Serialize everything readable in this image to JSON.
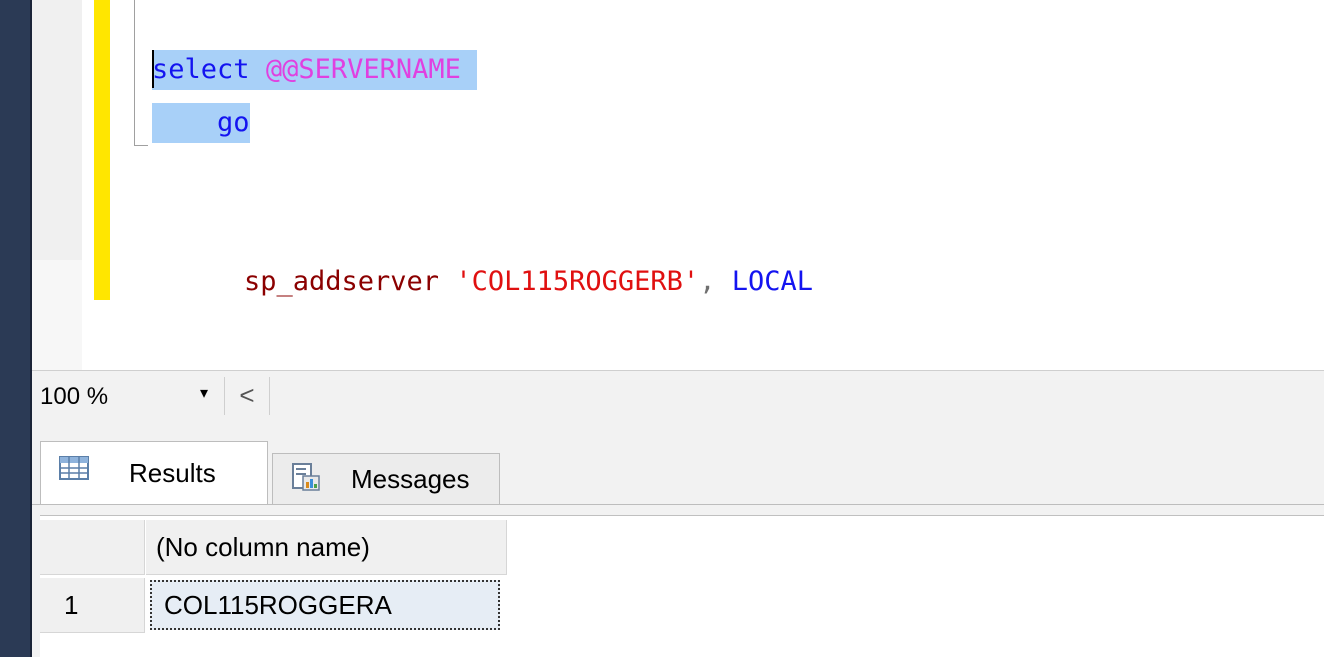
{
  "editor": {
    "lines": [
      {
        "kw": "select",
        "sysvar": "@@SERVERNAME"
      },
      {
        "kw": "go"
      },
      {
        "fn": "sp_addserver",
        "str": "'COL115ROGGERB'",
        "punc": ",",
        "kw": "LOCAL"
      }
    ]
  },
  "zoom": {
    "value": "100 %",
    "arrow": "▾",
    "scroll_left": "<"
  },
  "tabs": {
    "results_label": "Results",
    "messages_label": "Messages"
  },
  "grid": {
    "column_header": "(No column name)",
    "rows": [
      {
        "row_number": "1",
        "value": "COL115ROGGERA"
      }
    ]
  },
  "colors": {
    "selection": "#a8d0f8",
    "change_marker": "#ffe600",
    "keyword": "#1414f0",
    "system_variable": "#e040e0",
    "string": "#e01010",
    "left_rail": "#2b3a55"
  }
}
